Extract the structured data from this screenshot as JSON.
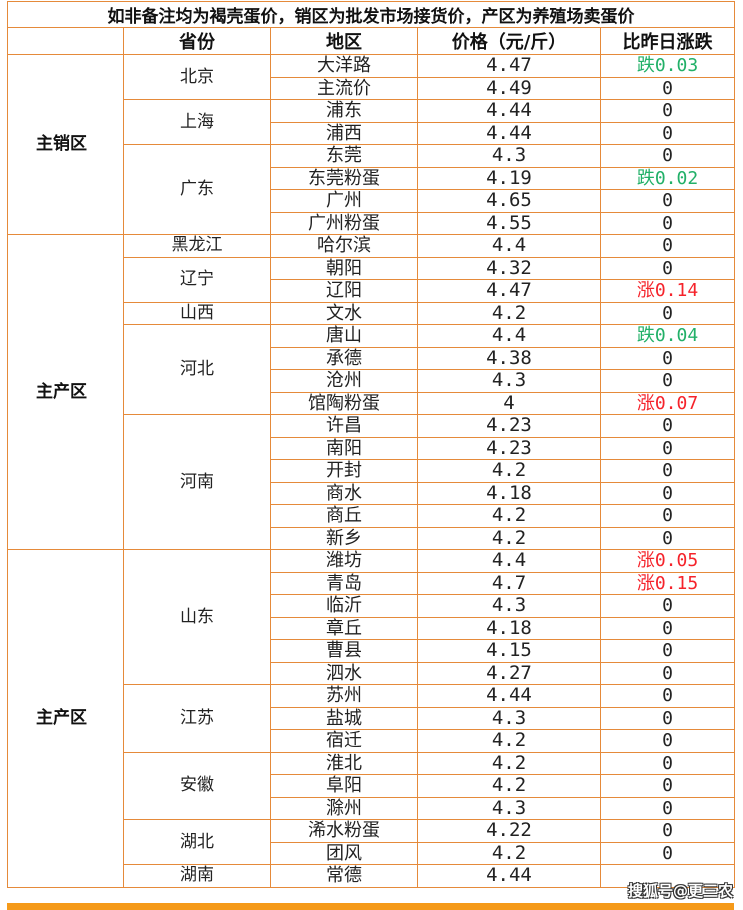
{
  "title": "如非备注均为褐壳蛋价，销区为批发市场接货价，产区为养殖场卖蛋价",
  "headers": [
    "",
    "省份",
    "地区",
    "价格（元/斤）",
    "比昨日涨跌"
  ],
  "colors": {
    "border": "#e58a3a",
    "up": "#f5232b",
    "down": "#22b068",
    "bar": "#f59a1a"
  },
  "watermark": "搜狐号@更三农",
  "zones": [
    {
      "name": "主销区",
      "provinces": [
        {
          "name": "北京",
          "rows": [
            {
              "area": "大洋路",
              "price": "4.47",
              "change": "跌0.03",
              "trend": "down"
            },
            {
              "area": "主流价",
              "price": "4.49",
              "change": "0",
              "trend": "flat"
            }
          ]
        },
        {
          "name": "上海",
          "rows": [
            {
              "area": "浦东",
              "price": "4.44",
              "change": "0",
              "trend": "flat"
            },
            {
              "area": "浦西",
              "price": "4.44",
              "change": "0",
              "trend": "flat"
            }
          ]
        },
        {
          "name": "广东",
          "rows": [
            {
              "area": "东莞",
              "price": "4.3",
              "change": "0",
              "trend": "flat"
            },
            {
              "area": "东莞粉蛋",
              "price": "4.19",
              "change": "跌0.02",
              "trend": "down"
            },
            {
              "area": "广州",
              "price": "4.65",
              "change": "0",
              "trend": "flat"
            },
            {
              "area": "广州粉蛋",
              "price": "4.55",
              "change": "0",
              "trend": "flat"
            }
          ]
        }
      ]
    },
    {
      "name": "主产区",
      "provinces": [
        {
          "name": "黑龙江",
          "rows": [
            {
              "area": "哈尔滨",
              "price": "4.4",
              "change": "0",
              "trend": "flat"
            }
          ]
        },
        {
          "name": "辽宁",
          "rows": [
            {
              "area": "朝阳",
              "price": "4.32",
              "change": "0",
              "trend": "flat"
            },
            {
              "area": "辽阳",
              "price": "4.47",
              "change": "涨0.14",
              "trend": "up"
            }
          ]
        },
        {
          "name": "山西",
          "rows": [
            {
              "area": "文水",
              "price": "4.2",
              "change": "0",
              "trend": "flat"
            }
          ]
        },
        {
          "name": "河北",
          "rows": [
            {
              "area": "唐山",
              "price": "4.4",
              "change": "跌0.04",
              "trend": "down"
            },
            {
              "area": "承德",
              "price": "4.38",
              "change": "0",
              "trend": "flat"
            },
            {
              "area": "沧州",
              "price": "4.3",
              "change": "0",
              "trend": "flat"
            },
            {
              "area": "馆陶粉蛋",
              "price": "4",
              "change": "涨0.07",
              "trend": "up"
            }
          ]
        },
        {
          "name": "河南",
          "rows": [
            {
              "area": "许昌",
              "price": "4.23",
              "change": "0",
              "trend": "flat"
            },
            {
              "area": "南阳",
              "price": "4.23",
              "change": "0",
              "trend": "flat"
            },
            {
              "area": "开封",
              "price": "4.2",
              "change": "0",
              "trend": "flat"
            },
            {
              "area": "商水",
              "price": "4.18",
              "change": "0",
              "trend": "flat"
            },
            {
              "area": "商丘",
              "price": "4.2",
              "change": "0",
              "trend": "flat"
            },
            {
              "area": "新乡",
              "price": "4.2",
              "change": "0",
              "trend": "flat"
            }
          ]
        }
      ]
    },
    {
      "name": "主产区",
      "provinces": [
        {
          "name": "山东",
          "rows": [
            {
              "area": "潍坊",
              "price": "4.4",
              "change": "涨0.05",
              "trend": "up"
            },
            {
              "area": "青岛",
              "price": "4.7",
              "change": "涨0.15",
              "trend": "up"
            },
            {
              "area": "临沂",
              "price": "4.3",
              "change": "0",
              "trend": "flat"
            },
            {
              "area": "章丘",
              "price": "4.18",
              "change": "0",
              "trend": "flat"
            },
            {
              "area": "曹县",
              "price": "4.15",
              "change": "0",
              "trend": "flat"
            },
            {
              "area": "泗水",
              "price": "4.27",
              "change": "0",
              "trend": "flat"
            }
          ]
        },
        {
          "name": "江苏",
          "rows": [
            {
              "area": "苏州",
              "price": "4.44",
              "change": "0",
              "trend": "flat"
            },
            {
              "area": "盐城",
              "price": "4.3",
              "change": "0",
              "trend": "flat"
            },
            {
              "area": "宿迁",
              "price": "4.2",
              "change": "0",
              "trend": "flat"
            }
          ]
        },
        {
          "name": "安徽",
          "rows": [
            {
              "area": "淮北",
              "price": "4.2",
              "change": "0",
              "trend": "flat"
            },
            {
              "area": "阜阳",
              "price": "4.2",
              "change": "0",
              "trend": "flat"
            },
            {
              "area": "滁州",
              "price": "4.3",
              "change": "0",
              "trend": "flat"
            }
          ]
        },
        {
          "name": "湖北",
          "rows": [
            {
              "area": "浠水粉蛋",
              "price": "4.22",
              "change": "0",
              "trend": "flat"
            },
            {
              "area": "团风",
              "price": "4.2",
              "change": "0",
              "trend": "flat"
            }
          ]
        },
        {
          "name": "湖南",
          "rows": [
            {
              "area": "常德",
              "price": "4.44",
              "change": "",
              "trend": "flat"
            }
          ]
        }
      ]
    }
  ]
}
